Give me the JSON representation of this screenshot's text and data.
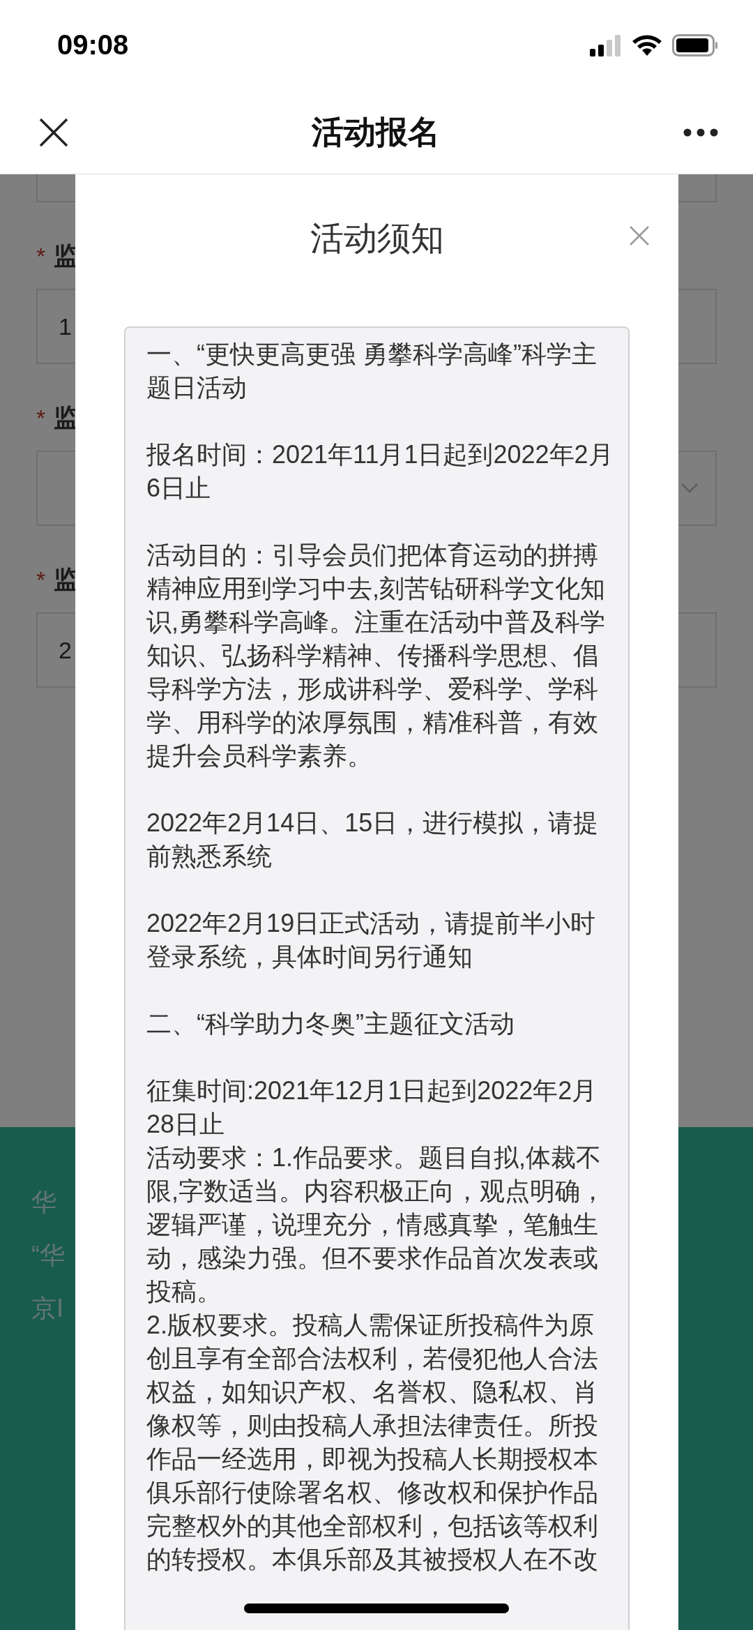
{
  "status_bar": {
    "time": "09:08"
  },
  "nav": {
    "title": "活动报名"
  },
  "form": {
    "fields": [
      {
        "required_mark": "*",
        "label": "监",
        "kind": "input",
        "value": "1"
      },
      {
        "required_mark": "*",
        "label": "监",
        "kind": "select"
      },
      {
        "required_mark": "*",
        "label": "监",
        "kind": "input",
        "value": "2"
      }
    ]
  },
  "footer": {
    "lines": [
      "华",
      "“华",
      "京I"
    ]
  },
  "notice": {
    "title": "活动须知",
    "blocks": [
      [
        "一、“更快更高更强 勇攀科学高峰”科学主题日活动"
      ],
      [
        "报名时间：2021年11月1日起到2022年2月6日止"
      ],
      [
        "活动目的：引导会员们把体育运动的拼搏精神应用到学习中去,刻苦钻研科学文化知识,勇攀科学高峰。注重在活动中普及科学知识、弘扬科学精神、传播科学思想、倡导科学方法，形成讲科学、爱科学、学科学、用科学的浓厚氛围，精准科普，有效提升会员科学素养。"
      ],
      [
        "2022年2月14日、15日，进行模拟，请提前熟悉系统"
      ],
      [
        "2022年2月19日正式活动，请提前半小时登录系统，具体时间另行通知"
      ],
      [
        "二、“科学助力冬奥”主题征文活动"
      ],
      [
        "征集时间:2021年12月1日起到2022年2月28日止",
        "活动要求：1.作品要求。题目自拟,体裁不限,字数适当。内容积极正向，观点明确，逻辑严谨，说理充分，情感真挚，笔触生动，感染力强。但不要求作品首次发表或投稿。",
        "2.版权要求。投稿人需保证所投稿件为原创且享有全部合法权利，若侵犯他人合法权益，如知识产权、名誉权、隐私权、肖像权等，则由投稿人承担法律责任。所投作品一经选用，即视为投稿人长期授权本俱乐部行使除署名权、修改权和保护作品完整权外的其他全部权利，包括该等权利的转授权。本俱乐部及其被授权人在不改"
      ]
    ]
  }
}
